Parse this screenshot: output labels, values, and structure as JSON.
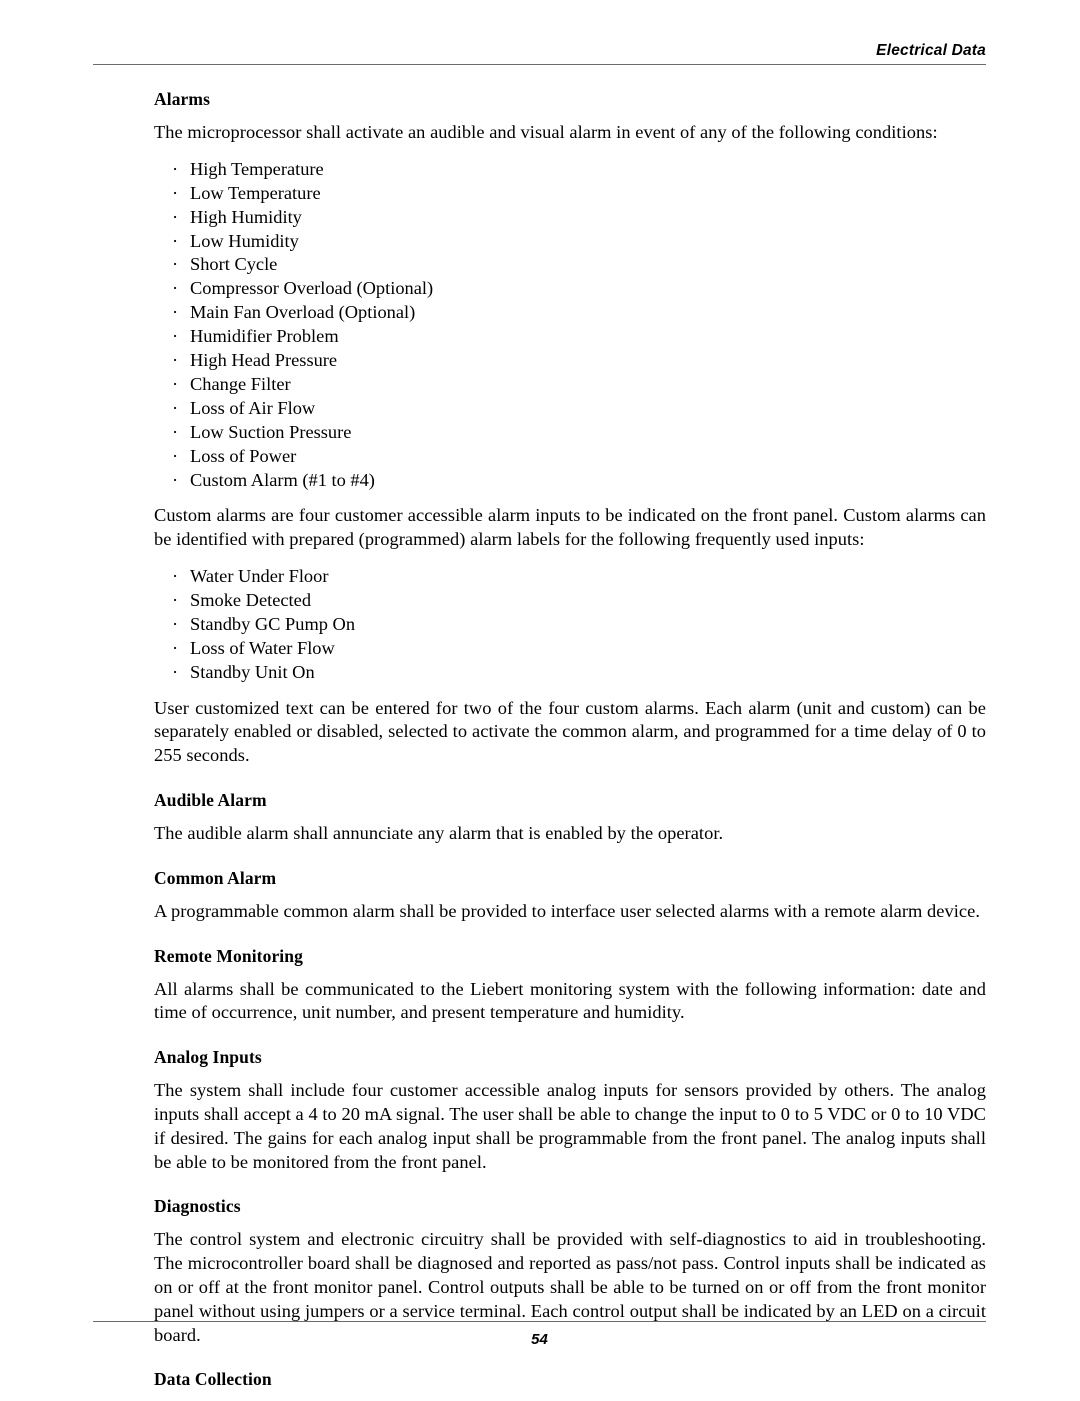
{
  "header": {
    "title": "Electrical Data"
  },
  "footer": {
    "page_number": "54"
  },
  "sections": {
    "alarms": {
      "heading": "Alarms",
      "intro": "The microprocessor shall activate an audible and visual alarm in event of any of the following conditions:",
      "alarm_list": [
        "High Temperature",
        "Low Temperature",
        "High Humidity",
        "Low Humidity",
        "Short Cycle",
        "Compressor Overload (Optional)",
        "Main Fan Overload (Optional)",
        "Humidifier Problem",
        "High Head Pressure",
        "Change Filter",
        "Loss of Air Flow",
        "Low Suction Pressure",
        "Loss of Power",
        "Custom Alarm (#1 to #4)"
      ],
      "custom_alarms_paragraph": "Custom alarms are four customer accessible alarm inputs to be indicated on the front panel. Custom alarms can be identified with prepared (programmed) alarm labels for the following frequently used inputs:",
      "custom_alarm_list": [
        "Water Under Floor",
        "Smoke Detected",
        "Standby GC Pump On",
        "Loss of Water Flow",
        "Standby Unit On"
      ],
      "custom_text_paragraph": "User customized text can be entered for two of the four custom alarms. Each alarm (unit and custom) can be separately enabled or disabled, selected to activate the common alarm, and programmed for a time delay of 0 to 255 seconds."
    },
    "audible_alarm": {
      "heading": "Audible Alarm",
      "paragraph": "The audible alarm shall annunciate any alarm that is enabled by the operator."
    },
    "common_alarm": {
      "heading": "Common Alarm",
      "paragraph": "A programmable common alarm shall be provided to interface user selected alarms with a remote alarm device."
    },
    "remote_monitoring": {
      "heading": "Remote Monitoring",
      "paragraph": "All alarms shall be communicated to the Liebert monitoring system with the following information: date and time of occurrence, unit number, and present temperature and humidity."
    },
    "analog_inputs": {
      "heading": "Analog Inputs",
      "paragraph": "The system shall include four customer accessible analog inputs for sensors provided by others. The analog inputs shall accept a 4 to 20 mA signal. The user shall be able to change the input to 0 to 5 VDC or 0 to 10 VDC if desired. The gains for each analog input shall be programmable from the front panel. The analog inputs shall be able to be monitored from the front panel."
    },
    "diagnostics": {
      "heading": "Diagnostics",
      "paragraph": "The control system and electronic circuitry shall be provided with self-diagnostics to aid in troubleshooting. The microcontroller board shall be diagnosed and reported as pass/not pass. Control inputs shall be indicated as on or off at the front monitor panel. Control outputs shall be able to be turned on or off from the front monitor panel without using jumpers or a service terminal. Each control output shall be indicated by an LED on a circuit board."
    },
    "data_collection": {
      "heading": "Data Collection"
    }
  },
  "bullet_glyph": "·"
}
